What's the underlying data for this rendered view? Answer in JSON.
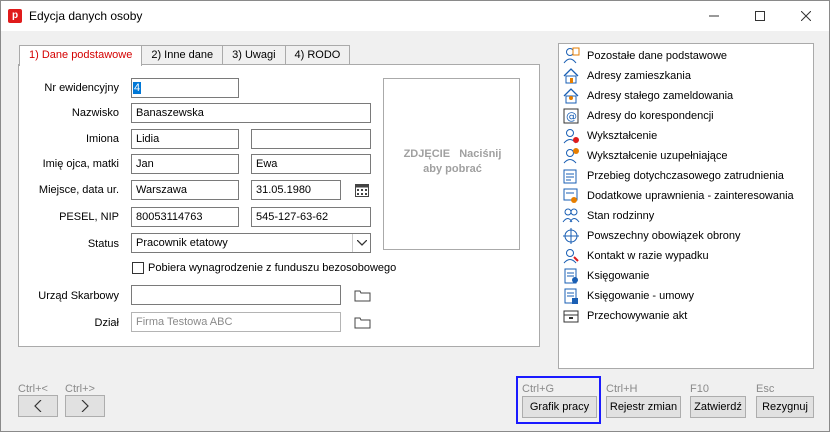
{
  "window": {
    "title": "Edycja danych osoby"
  },
  "tabs": [
    "1) Dane podstawowe",
    "2) Inne dane",
    "3) Uwagi",
    "4) RODO"
  ],
  "form": {
    "nr_ewidencyjny_label": "Nr ewidencyjny",
    "nr_ewidencyjny": "4",
    "nazwisko_label": "Nazwisko",
    "nazwisko": "Banaszewska",
    "imiona_label": "Imiona",
    "imie1": "Lidia",
    "imie2": "",
    "rodzice_label": "Imię ojca, matki",
    "ojciec": "Jan",
    "matka": "Ewa",
    "miejsce_data_label": "Miejsce, data ur.",
    "miejsce": "Warszawa",
    "data_ur": "31.05.1980",
    "pesel_nip_label": "PESEL, NIP",
    "pesel": "80053114763",
    "nip": "545-127-63-62",
    "status_label": "Status",
    "status": "Pracownik etatowy",
    "bezosobowy_label": "Pobiera wynagrodzenie z funduszu bezosobowego",
    "bezosobowy_checked": false,
    "urzad_label": "Urząd Skarbowy",
    "urzad": "",
    "dzial_label": "Dział",
    "dzial": "Firma Testowa ABC"
  },
  "photo": {
    "line1a": "ZDJĘCIE",
    "line1b": "Naciśnij",
    "line2": "aby pobrać"
  },
  "right_panel": [
    {
      "label": "Pozostałe dane podstawowe",
      "icon": "person-data-icon"
    },
    {
      "label": "Adresy zamieszkania",
      "icon": "home-icon"
    },
    {
      "label": "Adresy stałego zameldowania",
      "icon": "home-person-icon"
    },
    {
      "label": "Adresy do korespondencji",
      "icon": "at-mail-icon"
    },
    {
      "label": "Wykształcenie",
      "icon": "education-icon"
    },
    {
      "label": "Wykształcenie uzupełniające",
      "icon": "education-plus-icon"
    },
    {
      "label": "Przebieg dotychczasowego zatrudnienia",
      "icon": "employment-history-icon"
    },
    {
      "label": "Dodatkowe uprawnienia - zainteresowania",
      "icon": "certificate-icon"
    },
    {
      "label": "Stan rodzinny",
      "icon": "family-icon"
    },
    {
      "label": "Powszechny obowiązek obrony",
      "icon": "target-icon"
    },
    {
      "label": "Kontakt w razie wypadku",
      "icon": "emergency-contact-icon"
    },
    {
      "label": "Księgowanie",
      "icon": "accounting-icon"
    },
    {
      "label": "Księgowanie - umowy",
      "icon": "accounting-contract-icon"
    },
    {
      "label": "Przechowywanie akt",
      "icon": "archive-box-icon"
    }
  ],
  "bottom": {
    "prev_shortcut": "Ctrl+<",
    "next_shortcut": "Ctrl+>",
    "grafik_shortcut": "Ctrl+G",
    "grafik_label": "Grafik pracy",
    "rejestr_shortcut": "Ctrl+H",
    "rejestr_label": "Rejestr zmian",
    "zatwierdz_shortcut": "F10",
    "zatwierdz_label": "Zatwierdź",
    "rezygnuj_shortcut": "Esc",
    "rezygnuj_label": "Rezygnuj"
  },
  "colors": {
    "active_tab": "#d40000",
    "highlight": "#1a1aff",
    "photo_text": "#a0a0a0"
  }
}
